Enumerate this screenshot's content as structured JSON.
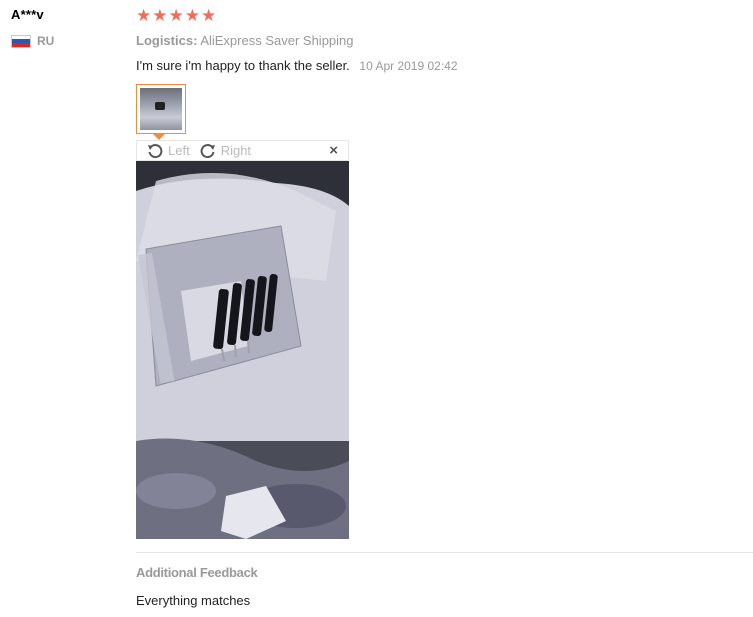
{
  "reviewer": {
    "name": "A***v",
    "country_code": "RU"
  },
  "rating": {
    "stars": 5,
    "max": 5,
    "star_color": "#f36d5a"
  },
  "logistics": {
    "label": "Logistics:",
    "value": "AliExpress Saver Shipping"
  },
  "review": {
    "text": "I'm sure i'm happy to thank the seller.",
    "date": "10 Apr 2019 02:42"
  },
  "image_viewer": {
    "rotate_left_label": "Left",
    "rotate_right_label": "Right",
    "close_symbol": "×",
    "accent_color": "#f08c3a"
  },
  "additional_feedback": {
    "title": "Additional Feedback",
    "text": "Everything matches"
  }
}
